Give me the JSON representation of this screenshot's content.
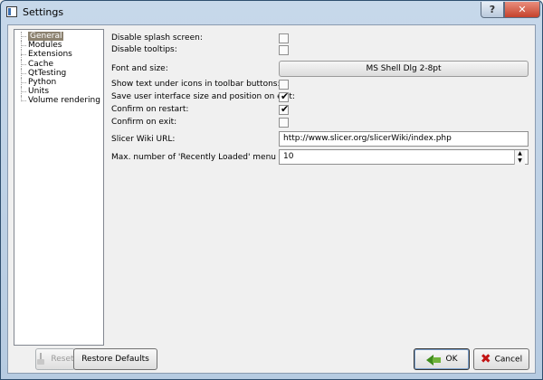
{
  "window": {
    "title": "Settings",
    "help_label": "?",
    "close_label": "✕"
  },
  "sidebar": {
    "items": [
      {
        "label": "General",
        "selected": true
      },
      {
        "label": "Modules"
      },
      {
        "label": "Extensions"
      },
      {
        "label": "Cache"
      },
      {
        "label": "QtTesting"
      },
      {
        "label": "Python"
      },
      {
        "label": "Units"
      },
      {
        "label": "Volume rendering"
      }
    ]
  },
  "general": {
    "disable_splash": {
      "label": "Disable splash screen:",
      "checked": false
    },
    "disable_tooltips": {
      "label": "Disable tooltips:",
      "checked": false
    },
    "font": {
      "label": "Font and size:",
      "value": "MS Shell Dlg 2-8pt"
    },
    "show_text_under_icons": {
      "label": "Show text under icons in toolbar buttons:",
      "checked": false
    },
    "save_ui_size": {
      "label": "Save user interface size and position on exit:",
      "checked": true
    },
    "confirm_restart": {
      "label": "Confirm on restart:",
      "checked": true
    },
    "confirm_exit": {
      "label": "Confirm on exit:",
      "checked": false
    },
    "wiki_url": {
      "label": "Slicer Wiki URL:",
      "value": "http://www.slicer.org/slicerWiki/index.php"
    },
    "recent_count": {
      "label": "Max. number of 'Recently Loaded' menu items:",
      "value": "10"
    }
  },
  "buttons": {
    "reset": {
      "label": "Reset",
      "enabled": false
    },
    "restore_defaults": {
      "label": "Restore Defaults"
    },
    "ok": {
      "label": "OK"
    },
    "cancel": {
      "label": "Cancel"
    }
  },
  "icons": {
    "app": "settings-window-icon",
    "reset": "broom-icon",
    "ok": "green-arrow-icon",
    "cancel": "red-x-icon"
  }
}
